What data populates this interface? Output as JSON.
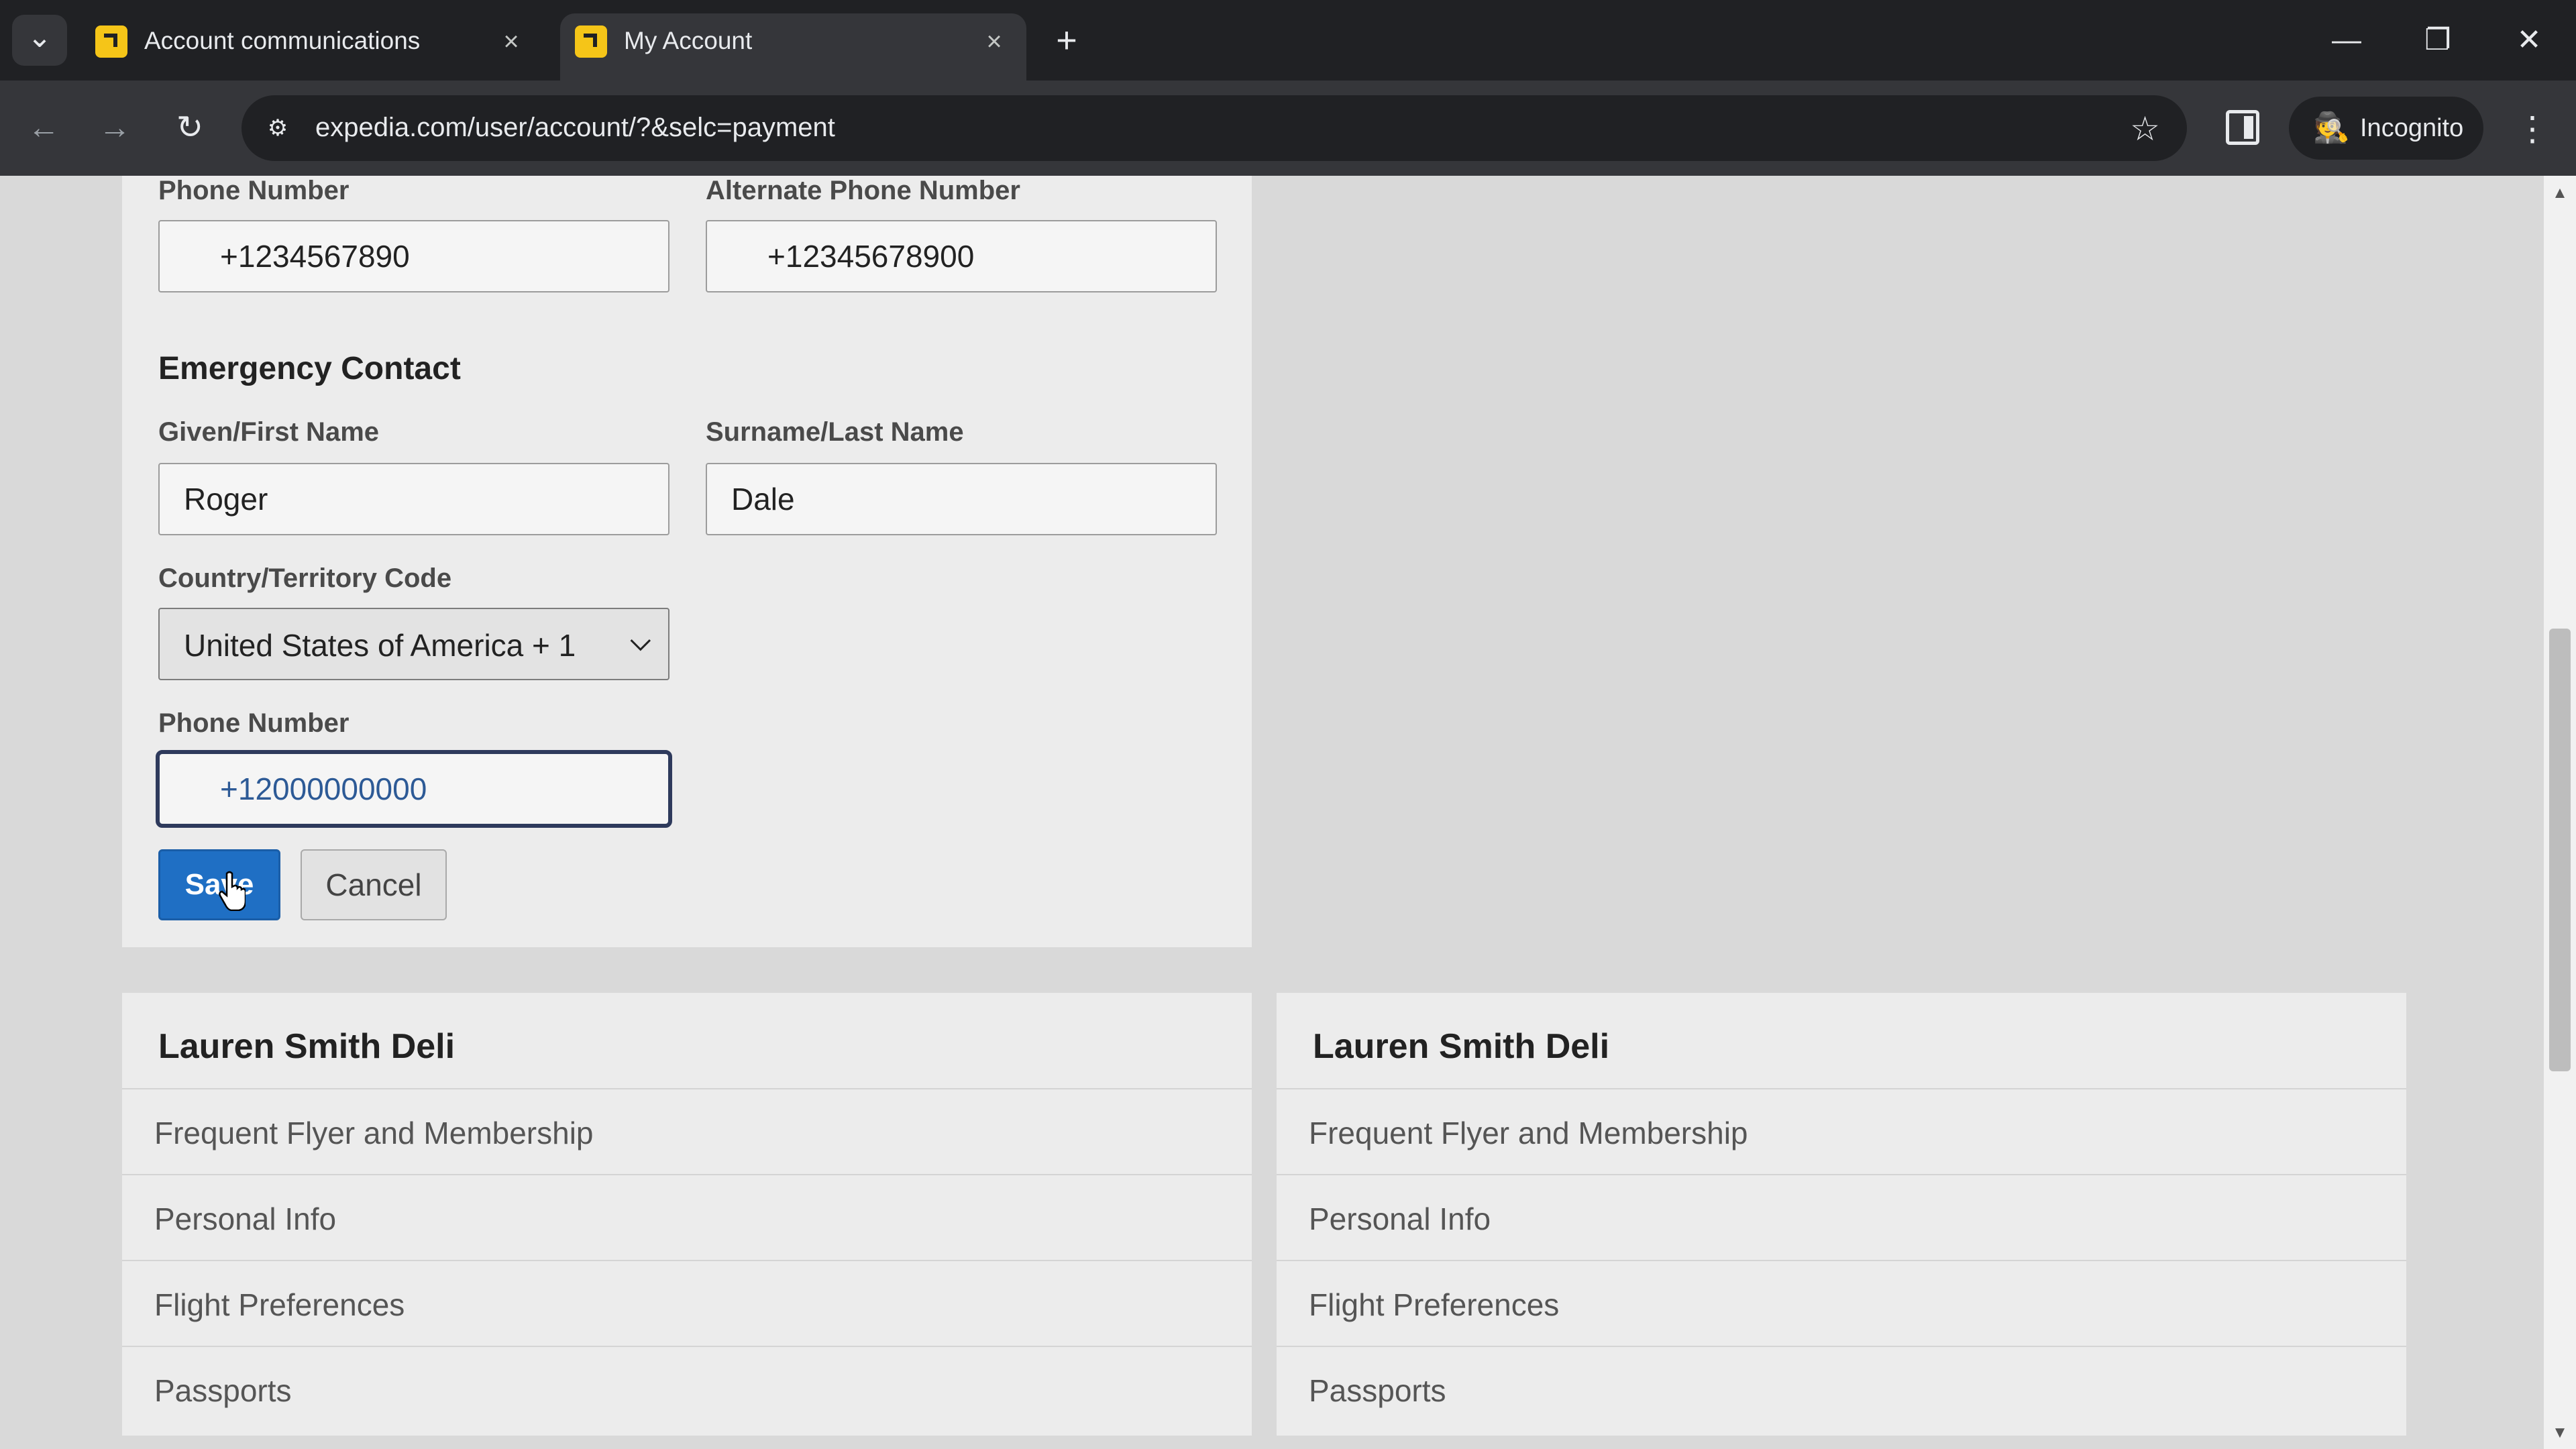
{
  "browser": {
    "tabs": [
      {
        "title": "Account communications",
        "active": false
      },
      {
        "title": "My Account",
        "active": true
      }
    ],
    "url": "expedia.com/user/account/?&selc=payment",
    "profile_label": "Incognito",
    "icons": {
      "tab_list": "chevron-down-icon",
      "favicon": "expedia-favicon",
      "close": "close-icon",
      "new_tab": "plus-icon",
      "back": "arrow-left-icon",
      "forward": "arrow-right-icon",
      "reload": "reload-icon",
      "site_info": "tune-icon",
      "bookmark": "star-icon",
      "side_panel": "side-panel-icon",
      "incognito": "incognito-icon",
      "menu": "kebab-icon",
      "minimize": "minimize-icon",
      "restore": "restore-icon",
      "window_close": "close-icon"
    },
    "glyphs": {
      "tab_list": "⌄",
      "close": "×",
      "new_tab": "+",
      "back": "←",
      "forward": "→",
      "reload": "↻",
      "site_info": "⚙",
      "star": "☆",
      "incognito": "🕵",
      "menu": "⋮",
      "minimize": "—",
      "restore": "❐",
      "window_close": "✕"
    }
  },
  "form": {
    "phone_label": "Phone Number",
    "phone_value": "+1234567890",
    "alt_phone_label": "Alternate Phone Number",
    "alt_phone_value": "+12345678900",
    "emergency_title": "Emergency Contact",
    "first_name_label": "Given/First Name",
    "first_name_value": "Roger",
    "last_name_label": "Surname/Last Name",
    "last_name_value": "Dale",
    "country_label": "Country/Territory Code",
    "country_value": "United States of America + 1",
    "emergency_phone_label": "Phone Number",
    "emergency_phone_value": "+12000000000",
    "save_label": "Save",
    "cancel_label": "Cancel"
  },
  "menu_cards": [
    {
      "title": "Lauren Smith Deli",
      "items": [
        "Frequent Flyer and Membership",
        "Personal Info",
        "Flight Preferences",
        "Passports"
      ]
    },
    {
      "title": "Lauren Smith Deli",
      "items": [
        "Frequent Flyer and Membership",
        "Personal Info",
        "Flight Preferences",
        "Passports"
      ]
    }
  ],
  "colors": {
    "primary_button": "#1f6fc4",
    "chrome_dark": "#202124",
    "chrome_toolbar": "#35363a",
    "favicon": "#f5c518"
  }
}
